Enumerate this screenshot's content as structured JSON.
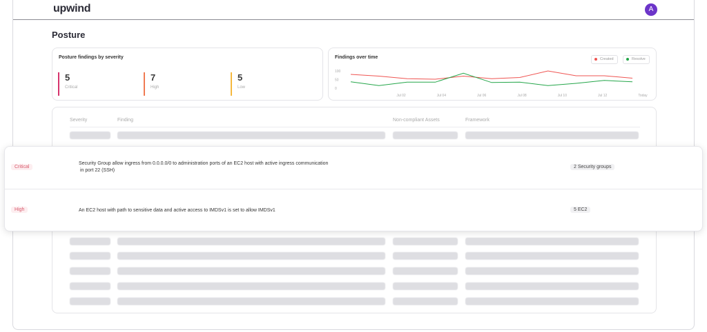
{
  "header": {
    "logo": "upwind",
    "avatar_initial": "A"
  },
  "page_title": "Posture",
  "severity_card": {
    "title": "Posture findings by severity",
    "items": [
      {
        "count": "5",
        "label": "Critical",
        "color": "#d6336c"
      },
      {
        "count": "7",
        "label": "High",
        "color": "#f07a52"
      },
      {
        "count": "5",
        "label": "Low",
        "color": "#f5b83d"
      }
    ]
  },
  "findings_card": {
    "title": "Findings over time",
    "legend": [
      {
        "label": "Created",
        "color": "#ef5350"
      },
      {
        "label": "Resolve",
        "color": "#22a548"
      }
    ]
  },
  "chart_data": {
    "type": "line",
    "title": "Findings over time",
    "x": [
      "",
      "Jul 02",
      "",
      "Jul 04",
      "",
      "Jul 06",
      "",
      "Jul 08",
      "",
      "Jul 10",
      "",
      "Jul 12",
      "",
      "Today"
    ],
    "x_tick_labels": [
      "Jul 02",
      "Jul 04",
      "Jul 06",
      "Jul 08",
      "Jul 10",
      "Jul 12",
      "Today"
    ],
    "y_tick_labels": [
      "100",
      "50",
      "0"
    ],
    "ylim": [
      0,
      120
    ],
    "series": [
      {
        "name": "Created",
        "color": "#ef5350",
        "values": [
          80,
          70,
          55,
          52,
          70,
          55,
          62,
          100,
          72,
          72,
          58
        ]
      },
      {
        "name": "Resolve",
        "color": "#22a548",
        "values": [
          37,
          15,
          35,
          35,
          87,
          33,
          35,
          15,
          28,
          45,
          37
        ]
      }
    ],
    "grid": false,
    "legend": "top-right"
  },
  "table": {
    "columns": [
      "Severity",
      "Finding",
      "Non-compliant Assets",
      "Framework"
    ]
  },
  "findings": [
    {
      "severity": "Critical",
      "finding_line1": "Security Group allow ingress from 0.0.0.0/0 to administration ports of an EC2 host with active ingress communication",
      "finding_line2": " in port 22 (SSH)",
      "assets": "2 Security groups"
    },
    {
      "severity": "High",
      "finding_line1": "An EC2 host with path to sensitive data and active access to IMDSv1 is set to allow IMDSv1",
      "finding_line2": "",
      "assets": "5 EC2"
    }
  ]
}
